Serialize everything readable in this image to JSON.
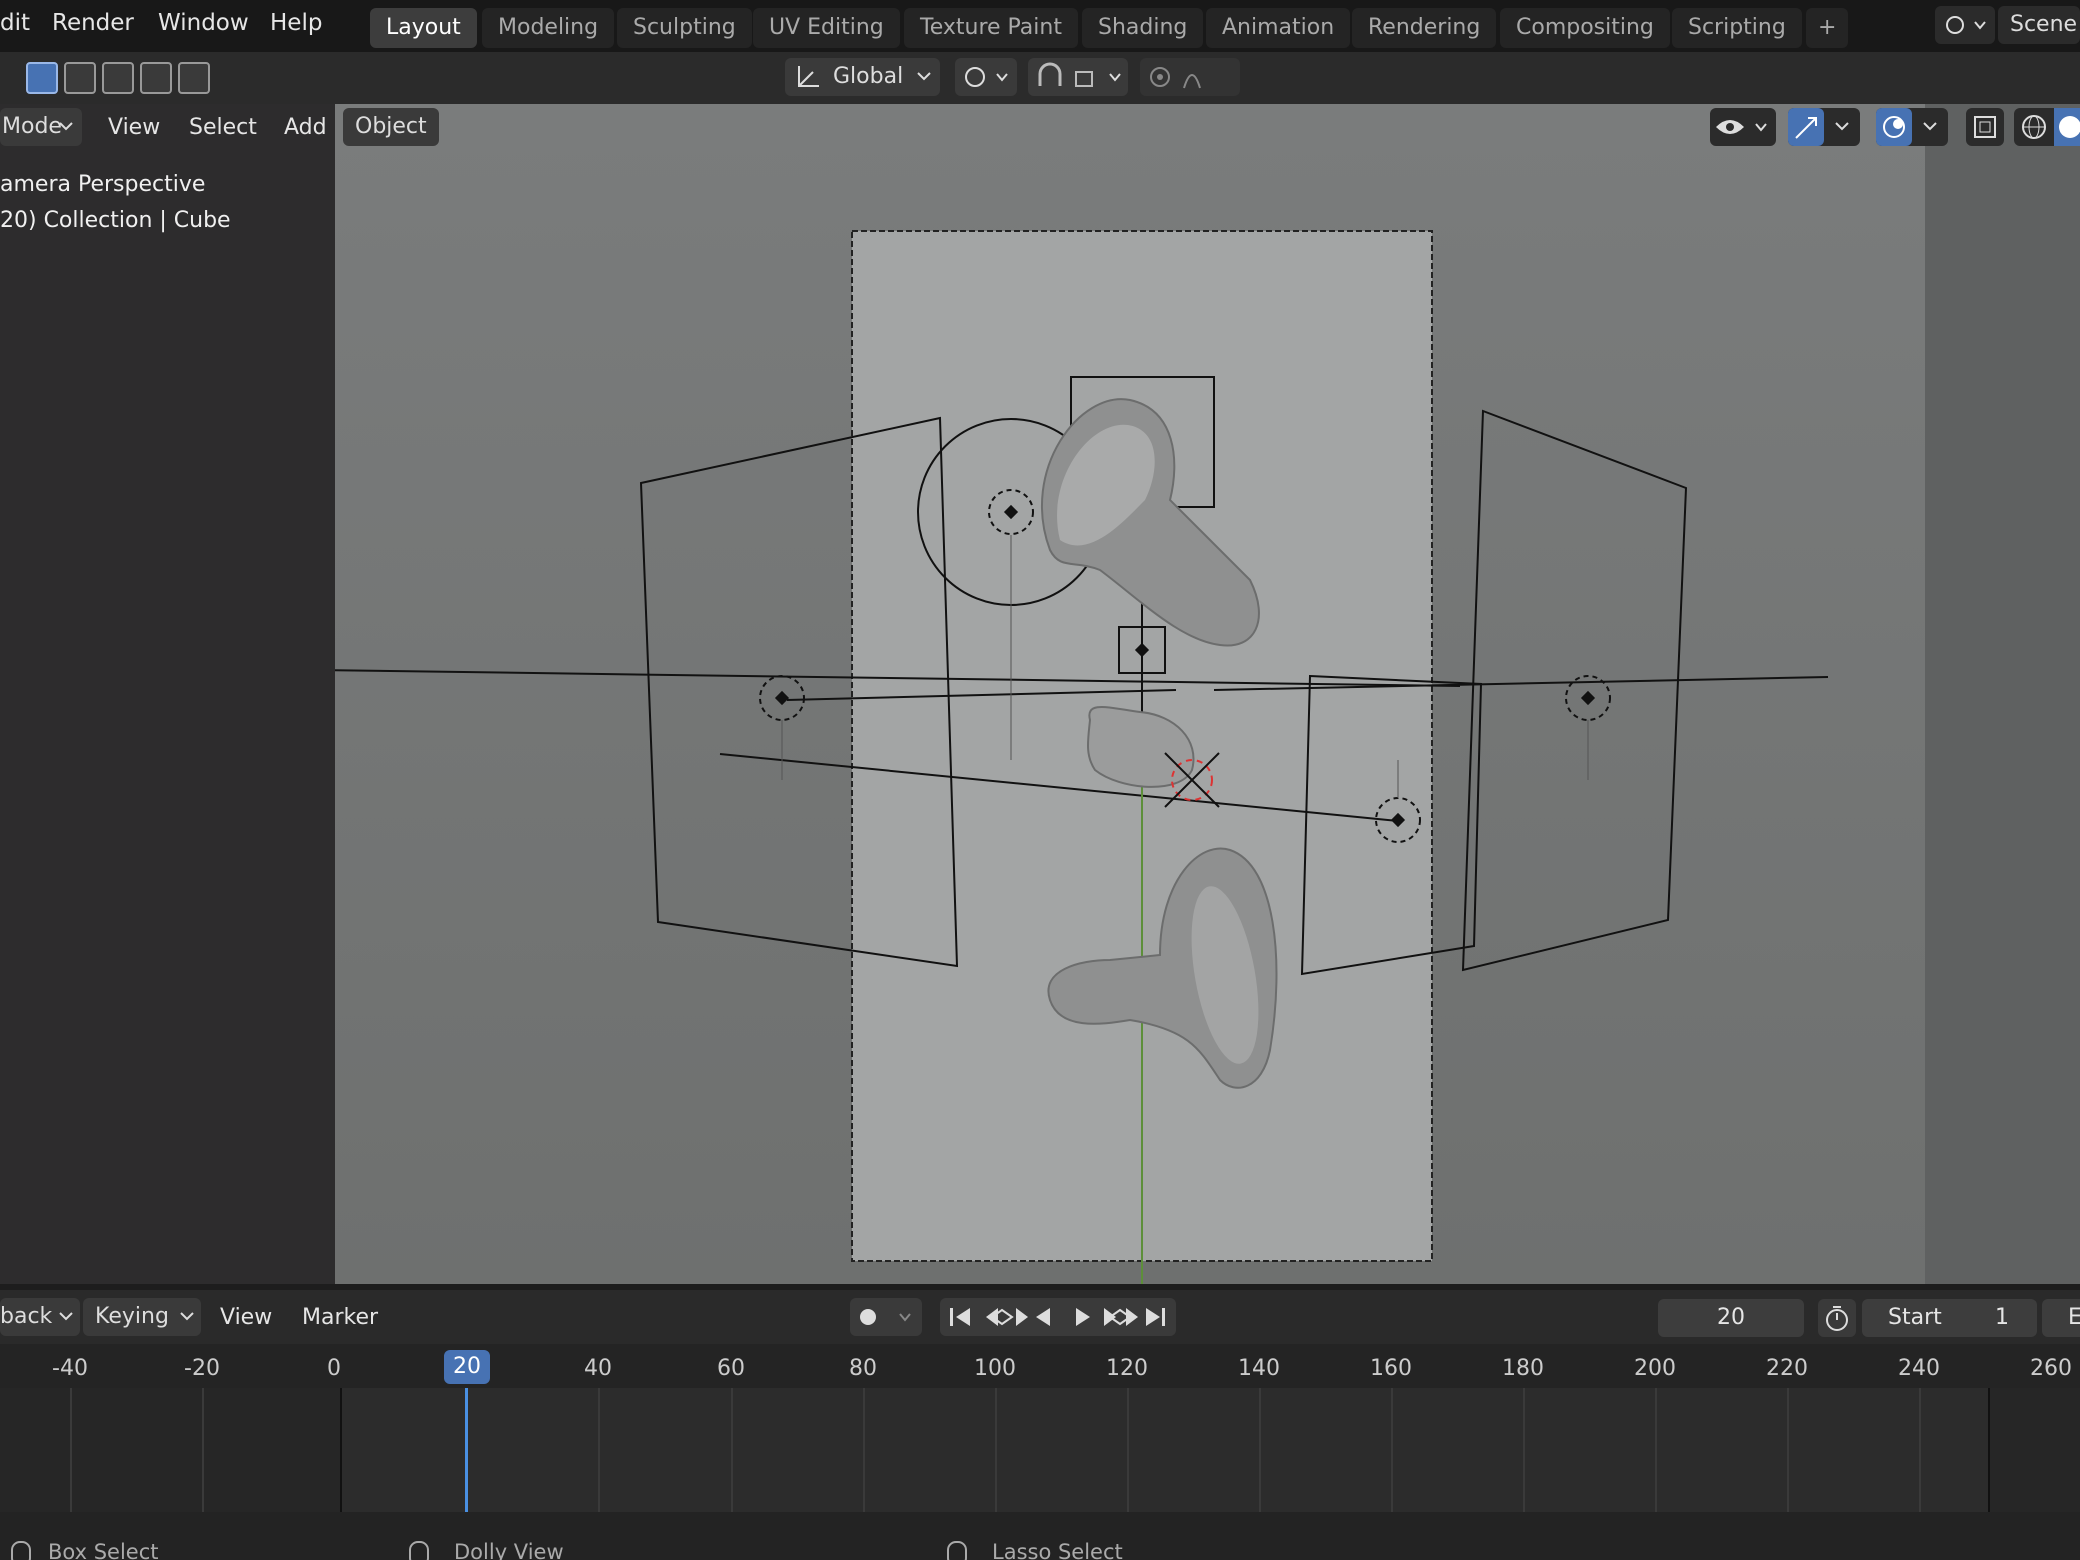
{
  "topbar": {
    "menus": [
      "dit",
      "Render",
      "Window",
      "Help"
    ],
    "workspaces": [
      "Layout",
      "Modeling",
      "Sculpting",
      "UV Editing",
      "Texture Paint",
      "Shading",
      "Animation",
      "Rendering",
      "Compositing",
      "Scripting"
    ],
    "add_workspace": "+",
    "scene_label": "Scene"
  },
  "toolbar": {
    "orientation": "Global"
  },
  "viewport_header": {
    "mode": "Mode",
    "view": "View",
    "select": "Select",
    "add": "Add",
    "object": "Object"
  },
  "overlay": {
    "line1": "amera Perspective",
    "line2": "20) Collection | Cube"
  },
  "timeline": {
    "playback": "back",
    "keying": "Keying",
    "view": "View",
    "marker": "Marker",
    "current_frame": "20",
    "start_label": "Start",
    "start_value": "1",
    "end_label": "E",
    "ticks": [
      "-40",
      "-20",
      "0",
      "20",
      "40",
      "60",
      "80",
      "100",
      "120",
      "140",
      "160",
      "180",
      "200",
      "220",
      "240",
      "260"
    ]
  },
  "statusbar": {
    "box_select": "Box Select",
    "dolly_view": "Dolly View",
    "lasso_select": "Lasso Select"
  },
  "colors": {
    "accent": "#4772b3",
    "playhead": "#4a90e2",
    "record": "#e03a4a"
  }
}
